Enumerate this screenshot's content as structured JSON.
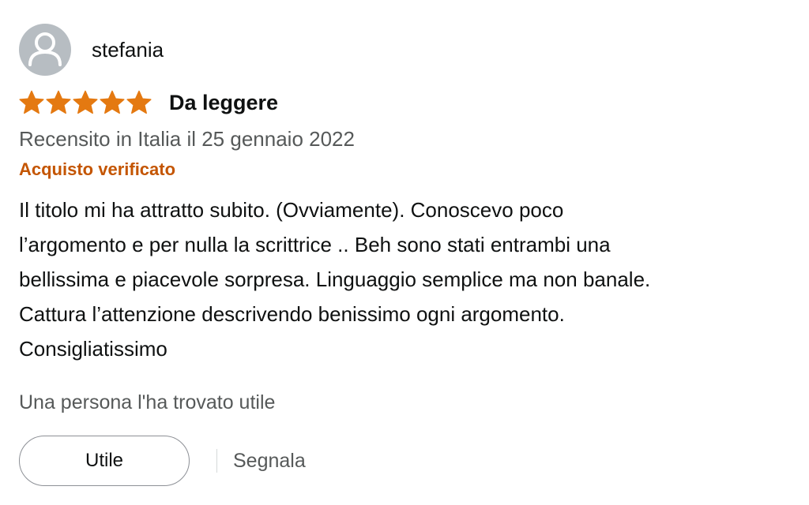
{
  "profile": {
    "name": "stefania",
    "avatar_icon": "user-silhouette-icon"
  },
  "review": {
    "rating": 5,
    "rating_max": 5,
    "star_color": "#e47911",
    "title": "Da leggere",
    "date_text": "Recensito in Italia il 25 gennaio 2022",
    "verified_label": "Acquisto verificato",
    "verified_color": "#c45500",
    "body_lines": [
      "Il titolo mi ha attratto subito. (Ovviamente). Conoscevo poco",
      "l’argomento e per nulla la scrittrice .. Beh sono stati entrambi una",
      "bellissima e piacevole sorpresa. Linguaggio semplice ma non banale.",
      "Cattura l’attenzione descrivendo benissimo ogni argomento.",
      "Consigliatissimo"
    ]
  },
  "helpful": {
    "count_text": "Una persona l'ha trovato utile",
    "button_label": "Utile",
    "report_label": "Segnala"
  }
}
